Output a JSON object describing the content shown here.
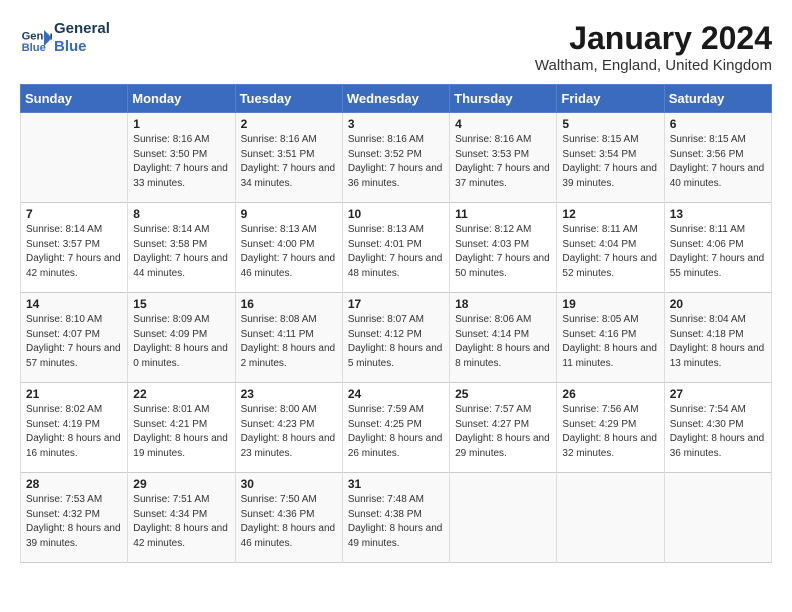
{
  "logo": {
    "text_general": "General",
    "text_blue": "Blue"
  },
  "header": {
    "month_title": "January 2024",
    "location": "Waltham, England, United Kingdom"
  },
  "days_of_week": [
    "Sunday",
    "Monday",
    "Tuesday",
    "Wednesday",
    "Thursday",
    "Friday",
    "Saturday"
  ],
  "weeks": [
    [
      {
        "day": "",
        "sunrise": "",
        "sunset": "",
        "daylight": ""
      },
      {
        "day": "1",
        "sunrise": "Sunrise: 8:16 AM",
        "sunset": "Sunset: 3:50 PM",
        "daylight": "Daylight: 7 hours and 33 minutes."
      },
      {
        "day": "2",
        "sunrise": "Sunrise: 8:16 AM",
        "sunset": "Sunset: 3:51 PM",
        "daylight": "Daylight: 7 hours and 34 minutes."
      },
      {
        "day": "3",
        "sunrise": "Sunrise: 8:16 AM",
        "sunset": "Sunset: 3:52 PM",
        "daylight": "Daylight: 7 hours and 36 minutes."
      },
      {
        "day": "4",
        "sunrise": "Sunrise: 8:16 AM",
        "sunset": "Sunset: 3:53 PM",
        "daylight": "Daylight: 7 hours and 37 minutes."
      },
      {
        "day": "5",
        "sunrise": "Sunrise: 8:15 AM",
        "sunset": "Sunset: 3:54 PM",
        "daylight": "Daylight: 7 hours and 39 minutes."
      },
      {
        "day": "6",
        "sunrise": "Sunrise: 8:15 AM",
        "sunset": "Sunset: 3:56 PM",
        "daylight": "Daylight: 7 hours and 40 minutes."
      }
    ],
    [
      {
        "day": "7",
        "sunrise": "Sunrise: 8:14 AM",
        "sunset": "Sunset: 3:57 PM",
        "daylight": "Daylight: 7 hours and 42 minutes."
      },
      {
        "day": "8",
        "sunrise": "Sunrise: 8:14 AM",
        "sunset": "Sunset: 3:58 PM",
        "daylight": "Daylight: 7 hours and 44 minutes."
      },
      {
        "day": "9",
        "sunrise": "Sunrise: 8:13 AM",
        "sunset": "Sunset: 4:00 PM",
        "daylight": "Daylight: 7 hours and 46 minutes."
      },
      {
        "day": "10",
        "sunrise": "Sunrise: 8:13 AM",
        "sunset": "Sunset: 4:01 PM",
        "daylight": "Daylight: 7 hours and 48 minutes."
      },
      {
        "day": "11",
        "sunrise": "Sunrise: 8:12 AM",
        "sunset": "Sunset: 4:03 PM",
        "daylight": "Daylight: 7 hours and 50 minutes."
      },
      {
        "day": "12",
        "sunrise": "Sunrise: 8:11 AM",
        "sunset": "Sunset: 4:04 PM",
        "daylight": "Daylight: 7 hours and 52 minutes."
      },
      {
        "day": "13",
        "sunrise": "Sunrise: 8:11 AM",
        "sunset": "Sunset: 4:06 PM",
        "daylight": "Daylight: 7 hours and 55 minutes."
      }
    ],
    [
      {
        "day": "14",
        "sunrise": "Sunrise: 8:10 AM",
        "sunset": "Sunset: 4:07 PM",
        "daylight": "Daylight: 7 hours and 57 minutes."
      },
      {
        "day": "15",
        "sunrise": "Sunrise: 8:09 AM",
        "sunset": "Sunset: 4:09 PM",
        "daylight": "Daylight: 8 hours and 0 minutes."
      },
      {
        "day": "16",
        "sunrise": "Sunrise: 8:08 AM",
        "sunset": "Sunset: 4:11 PM",
        "daylight": "Daylight: 8 hours and 2 minutes."
      },
      {
        "day": "17",
        "sunrise": "Sunrise: 8:07 AM",
        "sunset": "Sunset: 4:12 PM",
        "daylight": "Daylight: 8 hours and 5 minutes."
      },
      {
        "day": "18",
        "sunrise": "Sunrise: 8:06 AM",
        "sunset": "Sunset: 4:14 PM",
        "daylight": "Daylight: 8 hours and 8 minutes."
      },
      {
        "day": "19",
        "sunrise": "Sunrise: 8:05 AM",
        "sunset": "Sunset: 4:16 PM",
        "daylight": "Daylight: 8 hours and 11 minutes."
      },
      {
        "day": "20",
        "sunrise": "Sunrise: 8:04 AM",
        "sunset": "Sunset: 4:18 PM",
        "daylight": "Daylight: 8 hours and 13 minutes."
      }
    ],
    [
      {
        "day": "21",
        "sunrise": "Sunrise: 8:02 AM",
        "sunset": "Sunset: 4:19 PM",
        "daylight": "Daylight: 8 hours and 16 minutes."
      },
      {
        "day": "22",
        "sunrise": "Sunrise: 8:01 AM",
        "sunset": "Sunset: 4:21 PM",
        "daylight": "Daylight: 8 hours and 19 minutes."
      },
      {
        "day": "23",
        "sunrise": "Sunrise: 8:00 AM",
        "sunset": "Sunset: 4:23 PM",
        "daylight": "Daylight: 8 hours and 23 minutes."
      },
      {
        "day": "24",
        "sunrise": "Sunrise: 7:59 AM",
        "sunset": "Sunset: 4:25 PM",
        "daylight": "Daylight: 8 hours and 26 minutes."
      },
      {
        "day": "25",
        "sunrise": "Sunrise: 7:57 AM",
        "sunset": "Sunset: 4:27 PM",
        "daylight": "Daylight: 8 hours and 29 minutes."
      },
      {
        "day": "26",
        "sunrise": "Sunrise: 7:56 AM",
        "sunset": "Sunset: 4:29 PM",
        "daylight": "Daylight: 8 hours and 32 minutes."
      },
      {
        "day": "27",
        "sunrise": "Sunrise: 7:54 AM",
        "sunset": "Sunset: 4:30 PM",
        "daylight": "Daylight: 8 hours and 36 minutes."
      }
    ],
    [
      {
        "day": "28",
        "sunrise": "Sunrise: 7:53 AM",
        "sunset": "Sunset: 4:32 PM",
        "daylight": "Daylight: 8 hours and 39 minutes."
      },
      {
        "day": "29",
        "sunrise": "Sunrise: 7:51 AM",
        "sunset": "Sunset: 4:34 PM",
        "daylight": "Daylight: 8 hours and 42 minutes."
      },
      {
        "day": "30",
        "sunrise": "Sunrise: 7:50 AM",
        "sunset": "Sunset: 4:36 PM",
        "daylight": "Daylight: 8 hours and 46 minutes."
      },
      {
        "day": "31",
        "sunrise": "Sunrise: 7:48 AM",
        "sunset": "Sunset: 4:38 PM",
        "daylight": "Daylight: 8 hours and 49 minutes."
      },
      {
        "day": "",
        "sunrise": "",
        "sunset": "",
        "daylight": ""
      },
      {
        "day": "",
        "sunrise": "",
        "sunset": "",
        "daylight": ""
      },
      {
        "day": "",
        "sunrise": "",
        "sunset": "",
        "daylight": ""
      }
    ]
  ]
}
